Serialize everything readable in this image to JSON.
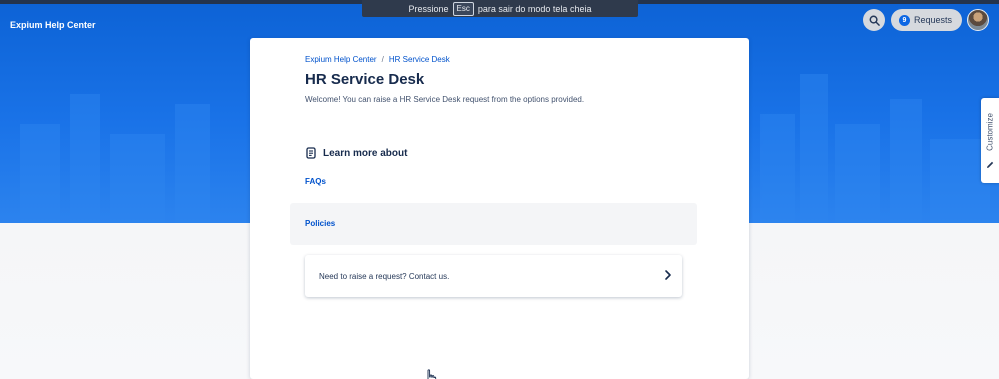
{
  "header": {
    "brand": "Expium Help Center",
    "fullscreen_notice": {
      "before": "Pressione",
      "key": "Esc",
      "after": "para sair do modo tela cheia"
    },
    "requests": {
      "count": "9",
      "label": "Requests"
    },
    "search_icon": "search-icon",
    "avatar_icon": "user-avatar"
  },
  "side_tab": {
    "label": "Customize",
    "icon": "pencil-icon"
  },
  "breadcrumb": [
    "Expium Help Center",
    "HR Service Desk"
  ],
  "breadcrumb_separator": "/",
  "page": {
    "title": "HR Service Desk",
    "welcome": "Welcome! You can raise a HR Service Desk request from the options provided."
  },
  "learn_more": {
    "heading": "Learn more about",
    "icon": "document-icon",
    "links": [
      "FAQs",
      "Policies"
    ]
  },
  "contact": {
    "text": "Need to raise a request? Contact us.",
    "icon": "chevron-right-icon"
  },
  "colors": {
    "banner": "#1a73e8",
    "link": "#0052cc",
    "title": "#172b4d",
    "badge": "#0c66e4"
  }
}
